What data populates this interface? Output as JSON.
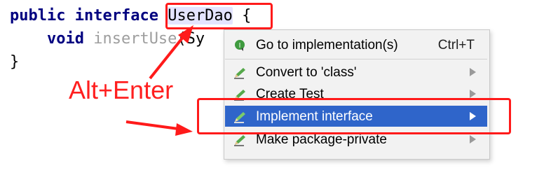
{
  "code": {
    "line1_kw1": "public",
    "line1_kw2": "interface",
    "line1_name": "UserDao",
    "line1_brace": "{",
    "line2_kw": "void",
    "line2_method": "insertUse",
    "line2_rest": "(Sy",
    "line3": "}"
  },
  "popup": {
    "items": [
      {
        "label": "Go to implementation(s)",
        "shortcut": "Ctrl+T",
        "icon": "implementation-icon"
      },
      {
        "label": "Convert to 'class'",
        "icon": "intention-pencil-icon"
      },
      {
        "label": "Create Test",
        "icon": "intention-pencil-icon"
      },
      {
        "label": "Implement interface",
        "icon": "intention-pencil-icon"
      },
      {
        "label": "Make package-private",
        "icon": "intention-pencil-icon"
      }
    ],
    "selected_index": 3
  },
  "annotation": {
    "text": "Alt+Enter",
    "color": "#ff1f1f"
  },
  "colors": {
    "keyword": "#000080",
    "selection": "#2f65ca",
    "annotation": "#ff1a1a"
  }
}
